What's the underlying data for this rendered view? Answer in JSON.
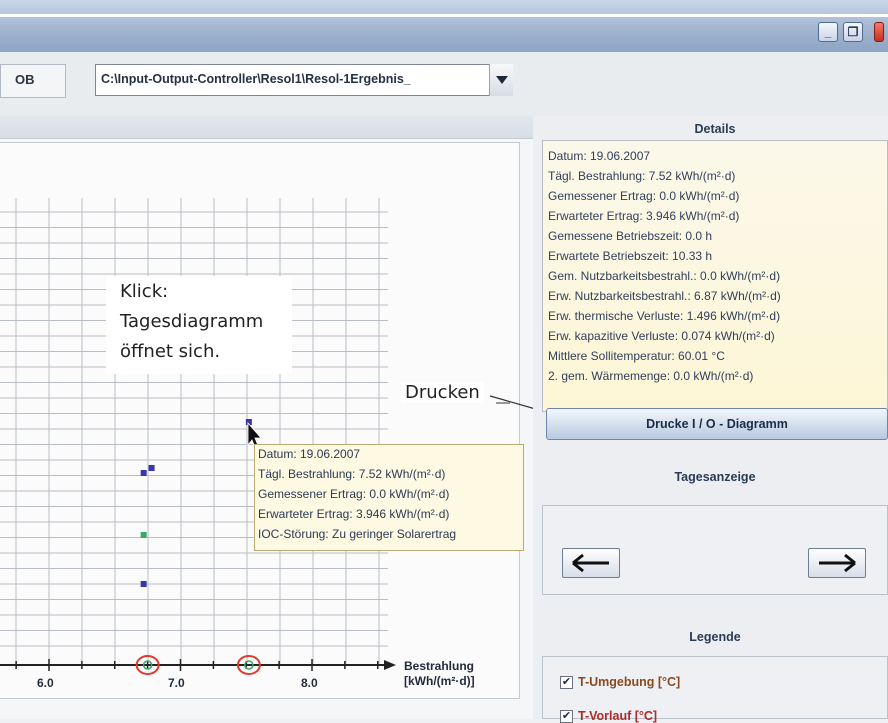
{
  "window": {
    "minimize_glyph": "_",
    "restore_glyph": "❐",
    "close_glyph": "✕",
    "accent": "#9fb3cf"
  },
  "toolbar": {
    "file_label": "OB",
    "path_value": "C:\\Input-Output-Controller\\Resol1\\Resol-1Ergebnis_",
    "dropdown_icon": "chevron-down-icon"
  },
  "details": {
    "title": "Details",
    "lines": [
      "Datum: 19.06.2007",
      "Tägl. Bestrahlung: 7.52 kWh/(m²·d)",
      "Gemessener Ertrag: 0.0 kWh/(m²·d)",
      "Erwarteter Ertrag: 3.946 kWh/(m²·d)",
      "Gemessene Betriebszeit: 0.0 h",
      "Erwartete Betriebszeit: 10.33 h",
      "Gem. Nutzbarkeitsbestrahl.: 0.0 kWh/(m²·d)",
      "Erw. Nutzbarkeitsbestrahl.: 6.87 kWh/(m²·d)",
      "Erw. thermische Verluste: 1.496 kWh/(m²·d)",
      "Erw. kapazitive Verluste: 0.074 kWh/(m²·d)",
      "Mittlere Sollitemperatur: 60.01 °C",
      "2. gem. Wärmemenge: 0.0 kWh/(m²·d)"
    ],
    "print_button": "Drucke I / O - Diagramm"
  },
  "day_nav": {
    "title": "Tagesanzeige",
    "prev_glyph": "←",
    "next_glyph": "→"
  },
  "legend": {
    "title": "Legende",
    "items": [
      {
        "label": "T-Umgebung [°C]",
        "checked": "✔"
      },
      {
        "label": "T-Vorlauf [°C]",
        "checked": "✔"
      }
    ]
  },
  "annotations": {
    "click_line1": "Klick:",
    "click_line2": "Tagesdiagramm",
    "click_line3": "öffnet sich.",
    "print_label": "Drucken"
  },
  "tooltip": {
    "lines": [
      "Datum: 19.06.2007",
      "Tägl. Bestrahlung: 7.52 kWh/(m²·d)",
      "Gemessener Ertrag: 0.0 kWh/(m²·d)",
      "Erwarteter Ertrag: 3.946 kWh/(m²·d)",
      "IOC-Störung: Zu geringer Solarertrag"
    ]
  },
  "chart_data": {
    "type": "scatter",
    "xlabel_line1": "Bestrahlung",
    "xlabel_line2": "[kWh/(m²·d)]",
    "xticks": [
      "6.0",
      "7.0",
      "8.0"
    ],
    "xlim": [
      5.5,
      8.5
    ],
    "series": [
      {
        "color": "#3a35a8",
        "points": [
          [
            7.52,
            0.0
          ],
          [
            6.72,
            0.0
          ],
          [
            6.68,
            0.0
          ],
          [
            6.7,
            0.0
          ]
        ]
      },
      {
        "color": "#3aa86a",
        "points": [
          [
            6.7,
            0.0
          ]
        ]
      }
    ],
    "highlight_circles": [
      6.75,
      7.52
    ],
    "colors": {
      "point_blue": "#3a35a8",
      "point_green": "#3aa86a",
      "circle": "#e03a2c"
    }
  }
}
